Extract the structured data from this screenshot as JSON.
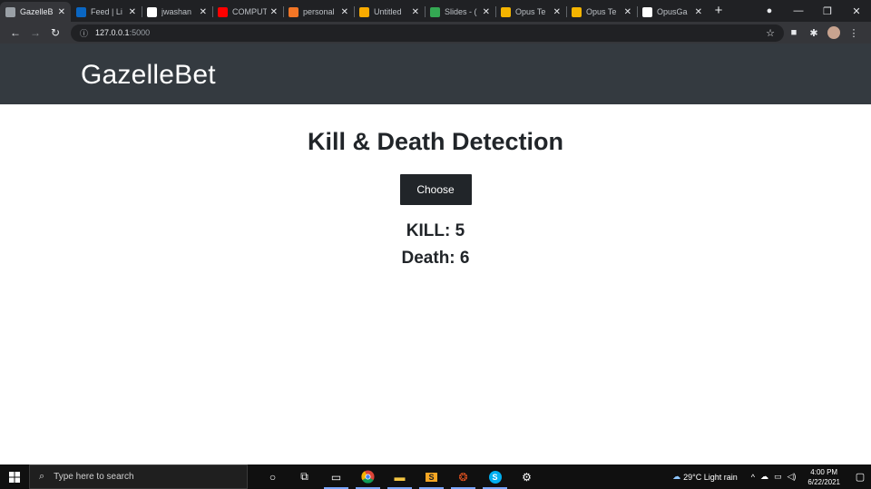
{
  "browser": {
    "tabs": [
      {
        "title": "GazelleB",
        "icon": "globe-icon",
        "color": "#9aa0a6",
        "active": true
      },
      {
        "title": "Feed | Li",
        "icon": "linkedin-icon",
        "color": "#0a66c2",
        "active": false
      },
      {
        "title": "jwashan",
        "icon": "github-icon",
        "color": "#ffffff",
        "active": false
      },
      {
        "title": "COMPUT",
        "icon": "youtube-icon",
        "color": "#ff0000",
        "active": false
      },
      {
        "title": "personal",
        "icon": "jupyter-icon",
        "color": "#f37626",
        "active": false
      },
      {
        "title": "Untitled",
        "icon": "colab-icon",
        "color": "#f9ab00",
        "active": false
      },
      {
        "title": "Slides - (",
        "icon": "drive-icon",
        "color": "#34a853",
        "active": false
      },
      {
        "title": "Opus Te",
        "icon": "slides-icon",
        "color": "#f4b400",
        "active": false
      },
      {
        "title": "Opus Te",
        "icon": "slides-icon",
        "color": "#f4b400",
        "active": false
      },
      {
        "title": "OpusGa",
        "icon": "github-icon",
        "color": "#ffffff",
        "active": false
      }
    ],
    "url_host": "127.0.0.1",
    "url_port": ":5000"
  },
  "app": {
    "brand": "GazelleBet",
    "title": "Kill & Death Detection",
    "choose_label": "Choose",
    "kill_text": "KILL: 5",
    "death_text": "Death: 6"
  },
  "taskbar": {
    "search_placeholder": "Type here to search",
    "weather": "29°C  Light rain",
    "time": "4:00 PM",
    "date": "6/22/2021"
  }
}
